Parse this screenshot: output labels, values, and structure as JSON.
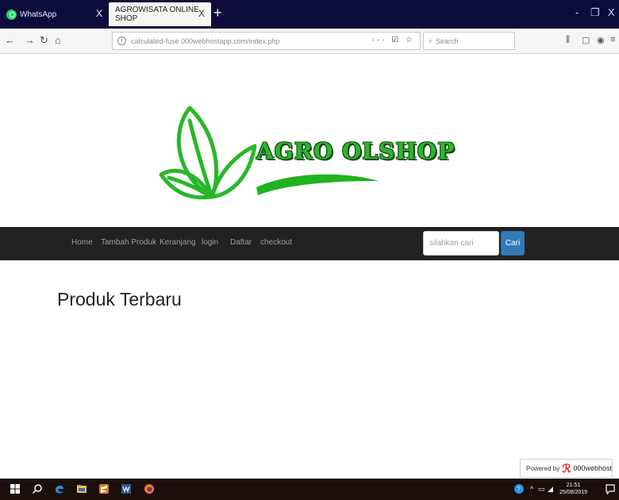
{
  "browser": {
    "tabs": [
      {
        "label": "WhatsApp"
      },
      {
        "label": "AGROWISATA ONLINE SHOP"
      }
    ],
    "tab_close": "X",
    "new_tab": "+",
    "window_controls": {
      "minimize": "-",
      "maximize": "❐",
      "close": "X"
    },
    "url": "calculated-fuse 000webhostapp.com/index.php",
    "url_actions": "··· ☑ ☆",
    "search_placeholder": "Search"
  },
  "site": {
    "brand": "AGRO OLSHOP",
    "nav_items": [
      "Home",
      "Tambah Produk",
      "Keranjang",
      "login",
      "Daftar",
      "checkout"
    ],
    "search_placeholder": "silahkan cari",
    "search_button": "Cari",
    "section_title": "Produk Terbaru",
    "brand_color": "#2fb52f"
  },
  "powered_badge": {
    "prefix": "Powered by",
    "host": "000webhost"
  },
  "taskbar": {
    "time": "21:51",
    "date": "25/08/2019"
  },
  "icons": [
    "whatsapp-icon",
    "back-icon",
    "forward-icon",
    "reload-icon",
    "home-icon",
    "info-icon",
    "search-icon",
    "library-icon",
    "sidebar-icon",
    "menu-icon",
    "leaf-logo-icon",
    "windows-start-icon",
    "cortana-search-icon",
    "edge-icon",
    "file-explorer-icon",
    "sublime-icon",
    "word-icon",
    "firefox-icon",
    "notification-icon"
  ]
}
